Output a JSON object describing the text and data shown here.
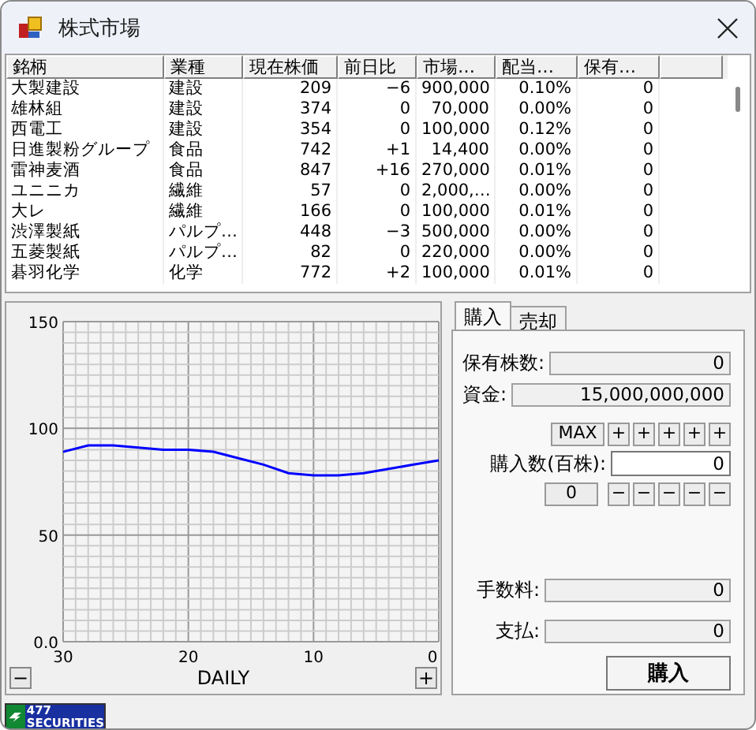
{
  "window": {
    "title": "株式市場"
  },
  "table": {
    "columns": [
      "銘柄",
      "業種",
      "現在株価",
      "前日比",
      "市場…",
      "配当…",
      "保有…"
    ],
    "rows": [
      [
        "大製建設",
        "建設",
        "209",
        "−6",
        "900,000",
        "0.10%",
        "0"
      ],
      [
        "雄林組",
        "建設",
        "374",
        "0",
        "70,000",
        "0.00%",
        "0"
      ],
      [
        "西電工",
        "建設",
        "354",
        "0",
        "100,000",
        "0.12%",
        "0"
      ],
      [
        "日進製粉グループ",
        "食品",
        "742",
        "+1",
        "14,400",
        "0.00%",
        "0"
      ],
      [
        "雷神麦酒",
        "食品",
        "847",
        "+16",
        "270,000",
        "0.01%",
        "0"
      ],
      [
        "ユニニカ",
        "繊維",
        "57",
        "0",
        "2,000,…",
        "0.00%",
        "0"
      ],
      [
        "大レ",
        "繊維",
        "166",
        "0",
        "100,000",
        "0.01%",
        "0"
      ],
      [
        "渋澤製紙",
        "パルプ…",
        "448",
        "−3",
        "500,000",
        "0.00%",
        "0"
      ],
      [
        "五菱製紙",
        "パルプ…",
        "82",
        "0",
        "220,000",
        "0.00%",
        "0"
      ],
      [
        "碁羽化学",
        "化学",
        "772",
        "+2",
        "100,000",
        "0.01%",
        "0"
      ]
    ]
  },
  "chart": {
    "period": "DAILY",
    "zoom_out": "−",
    "zoom_in": "+",
    "chart_data": {
      "type": "line",
      "x": [
        30,
        28,
        26,
        24,
        22,
        20,
        18,
        16,
        14,
        12,
        10,
        8,
        6,
        4,
        2,
        0
      ],
      "series": [
        {
          "color": "#0000ff",
          "values": [
            89,
            92,
            92,
            91,
            90,
            90,
            89,
            86,
            83,
            79,
            78,
            78,
            79,
            81,
            83,
            85
          ]
        }
      ],
      "grid": true,
      "xlim": [
        30,
        0
      ],
      "ylim": [
        0,
        150
      ],
      "xticks": [
        30,
        20,
        10,
        0
      ],
      "yticks": [
        {
          "value": 0,
          "label": "0.0"
        },
        50,
        100,
        150
      ]
    }
  },
  "trade": {
    "tabs": [
      {
        "label": "購入",
        "selected": true
      },
      {
        "label": "売却",
        "selected": false
      }
    ],
    "holdings": {
      "label": "保有株数:",
      "value": "0"
    },
    "funds": {
      "label": "資金:",
      "value": "15,000,000,000"
    },
    "max_button": "MAX",
    "plus_buttons": [
      "+",
      "+",
      "+",
      "+",
      "+"
    ],
    "quantity": {
      "label": "購入数(百株):",
      "value": "0"
    },
    "zero_button": "0",
    "minus_buttons": [
      "−",
      "−",
      "−",
      "−",
      "−"
    ],
    "fee": {
      "label": "手数料:",
      "value": "0"
    },
    "payment": {
      "label": "支払:",
      "value": "0"
    },
    "submit": "購入"
  },
  "logo": {
    "number": "477",
    "name": "SECURITIES"
  }
}
